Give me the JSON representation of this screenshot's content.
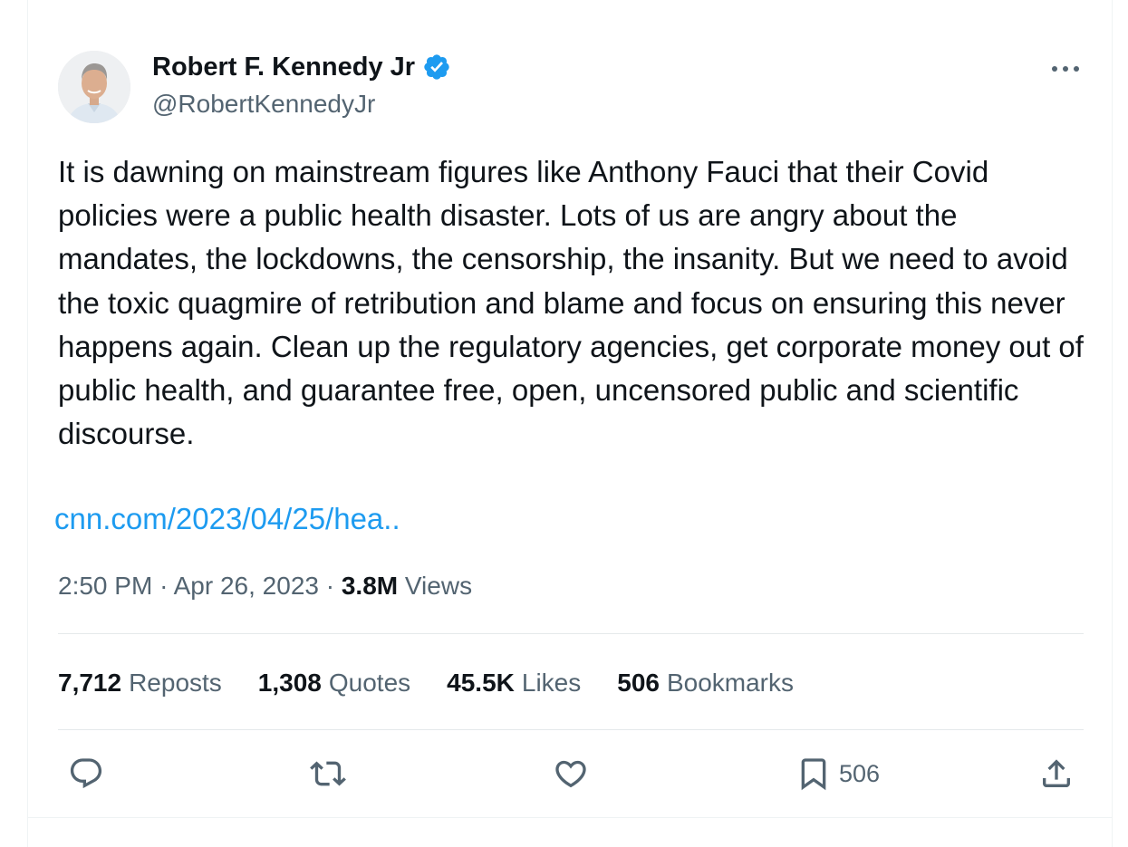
{
  "author": {
    "display_name": "Robert F. Kennedy Jr",
    "handle": "@RobertKennedyJr",
    "verified": true,
    "verified_color": "#1d9bf0"
  },
  "tweet": {
    "text": "It is dawning on mainstream figures like Anthony Fauci that their Covid policies were a public health disaster. Lots of us are angry about the mandates, the lockdowns, the censorship, the insanity. But we need to avoid the toxic quagmire of retribution and blame and focus on ensuring this never happens again. Clean up the regulatory agencies, get corporate money out of public health, and guarantee free, open, uncensored public and scientific discourse.",
    "link": "cnn.com/2023/04/25/hea..",
    "time": "2:50 PM",
    "separator": "·",
    "date": "Apr 26, 2023",
    "views_count": "3.8M",
    "views_label": "Views"
  },
  "stats": {
    "reposts": {
      "count": "7,712",
      "label": "Reposts"
    },
    "quotes": {
      "count": "1,308",
      "label": "Quotes"
    },
    "likes": {
      "count": "45.5K",
      "label": "Likes"
    },
    "bookmarks": {
      "count": "506",
      "label": "Bookmarks"
    }
  },
  "actions": {
    "reply_icon": "speech-bubble-icon",
    "repost_icon": "repost-arrows-icon",
    "like_icon": "heart-icon",
    "bookmark_icon": "bookmark-icon",
    "bookmark_count": "506",
    "share_icon": "share-upload-icon",
    "icon_color": "#536471"
  },
  "colors": {
    "text": "#0f1419",
    "secondary": "#536471",
    "accent": "#1d9bf0",
    "divider": "#e5e9eb"
  }
}
